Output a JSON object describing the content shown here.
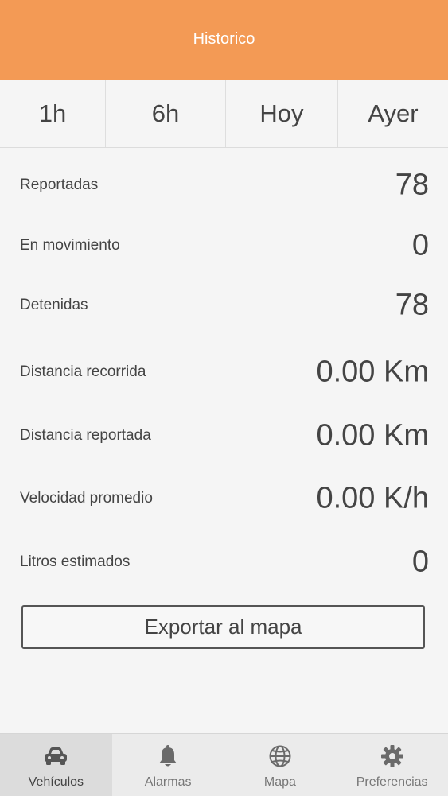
{
  "header": {
    "title": "Historico"
  },
  "tabs": [
    "1h",
    "6h",
    "Hoy",
    "Ayer"
  ],
  "stats": [
    {
      "label": "Reportadas",
      "value": "78"
    },
    {
      "label": "En movimiento",
      "value": "0"
    },
    {
      "label": "Detenidas",
      "value": "78"
    },
    {
      "label": "Distancia recorrida",
      "value": "0.00 Km"
    },
    {
      "label": "Distancia reportada",
      "value": "0.00 Km"
    },
    {
      "label": "Velocidad promedio",
      "value": "0.00 K/h"
    },
    {
      "label": "Litros estimados",
      "value": "0"
    }
  ],
  "export_button": {
    "label": "Exportar al mapa"
  },
  "bottom_nav": {
    "items": [
      {
        "label": "Vehículos",
        "icon": "car-icon",
        "active": true
      },
      {
        "label": "Alarmas",
        "icon": "bell-icon",
        "active": false
      },
      {
        "label": "Mapa",
        "icon": "globe-icon",
        "active": false
      },
      {
        "label": "Preferencias",
        "icon": "gear-icon",
        "active": false
      }
    ]
  },
  "colors": {
    "header_bg": "#f39a55",
    "header_text": "#ffffff",
    "page_bg": "#f5f5f5",
    "text": "#444444"
  }
}
